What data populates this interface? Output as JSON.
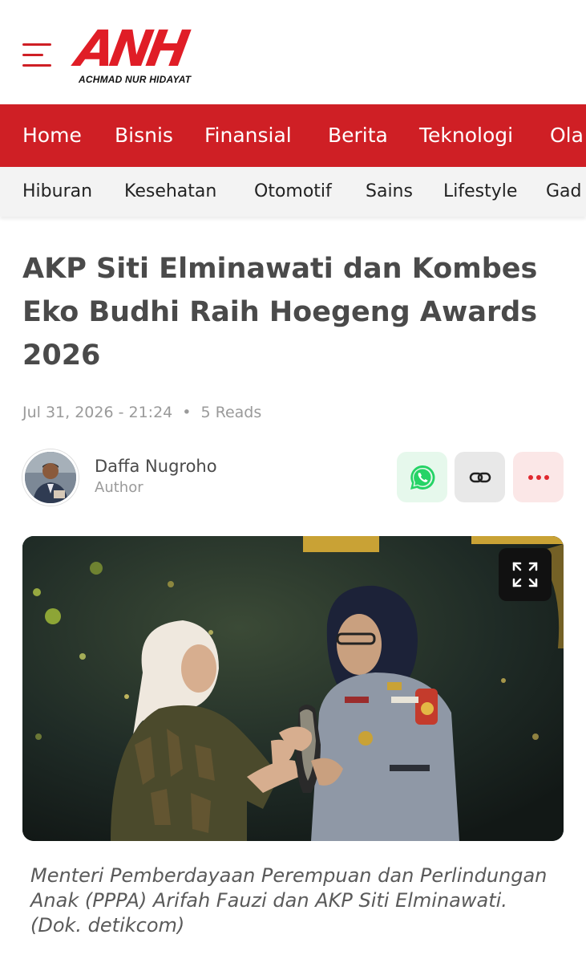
{
  "header": {
    "menu_icon": "hamburger-icon",
    "logo": {
      "mark": "ANH",
      "subtitle": "ACHMAD NUR HIDAYAT",
      "color": "#e01d26"
    }
  },
  "nav_primary": {
    "color": "#cf1f25",
    "items": [
      "Home",
      "Bisnis",
      "Finansial",
      "Berita",
      "Teknologi",
      "Ola"
    ]
  },
  "nav_secondary": {
    "items": [
      "Hiburan",
      "Kesehatan",
      "Otomotif",
      "Sains",
      "Lifestyle",
      "Gad"
    ]
  },
  "article": {
    "title": "AKP Siti Elminawati dan Kombes Eko Budhi Raih Hoegeng Awards 2026",
    "date": "Jul 31, 2026 - 21:24",
    "separator": "•",
    "reads": "5 Reads",
    "author": {
      "name": "Daffa Nugroho",
      "role": "Author"
    },
    "share": {
      "whatsapp_icon": "whatsapp-icon",
      "link_icon": "link-icon",
      "more_icon": "more-dots-icon"
    },
    "image": {
      "expand_icon": "expand-icon"
    },
    "caption": "Menteri Pemberdayaan Perempuan dan Perlindungan Anak (PPPA) Arifah Fauzi dan AKP Siti Elminawati. (Dok. detikcom)"
  }
}
